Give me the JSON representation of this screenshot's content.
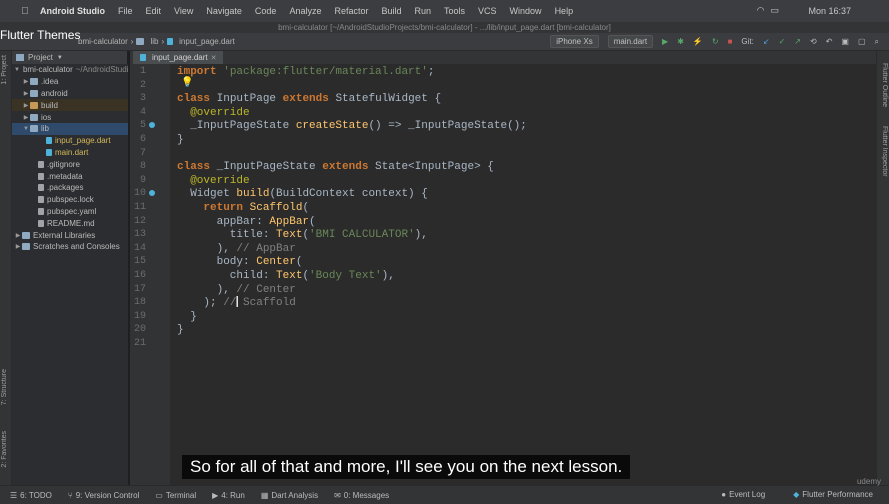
{
  "video_title": "Flutter Themes",
  "menubar": {
    "items": [
      "Android Studio",
      "File",
      "Edit",
      "View",
      "Navigate",
      "Code",
      "Analyze",
      "Refactor",
      "Build",
      "Run",
      "Tools",
      "VCS",
      "Window",
      "Help"
    ],
    "clock": "Mon 16:37"
  },
  "window_title": "bmi-calculator [~/AndroidStudioProjects/bmi-calculator] - .../lib/input_page.dart [bmi-calculator]",
  "navbar": {
    "breadcrumbs": [
      "bmi-calculator",
      "lib",
      "input_page.dart"
    ],
    "device": "iPhone Xs",
    "run_config": "main.dart",
    "git_label": "Git:"
  },
  "project_panel": {
    "header": "Project",
    "tree": [
      {
        "label": "bmi-calculator",
        "suffix": "~/AndroidStudioProjects/bmi-calculator",
        "type": "folder",
        "arrow": "▼"
      },
      {
        "label": ".idea",
        "type": "folder",
        "arrow": "▶"
      },
      {
        "label": "android",
        "type": "folder",
        "arrow": "▶"
      },
      {
        "label": "build",
        "type": "folder-orange",
        "arrow": "▶"
      },
      {
        "label": "ios",
        "type": "folder",
        "arrow": "▶"
      },
      {
        "label": "lib",
        "type": "folder",
        "arrow": "▼"
      },
      {
        "label": "input_page.dart",
        "type": "dart"
      },
      {
        "label": "main.dart",
        "type": "dart"
      },
      {
        "label": ".gitignore",
        "type": "file"
      },
      {
        "label": ".metadata",
        "type": "file"
      },
      {
        "label": ".packages",
        "type": "file"
      },
      {
        "label": "pubspec.lock",
        "type": "file"
      },
      {
        "label": "pubspec.yaml",
        "type": "file"
      },
      {
        "label": "README.md",
        "type": "file"
      },
      {
        "label": "External Libraries",
        "type": "lib",
        "arrow": "▶"
      },
      {
        "label": "Scratches and Consoles",
        "type": "lib",
        "arrow": "▶"
      }
    ]
  },
  "left_strip": {
    "project": "1: Project",
    "structure": "7: Structure",
    "favorites": "2: Favorites"
  },
  "right_strip": {
    "outline": "Flutter Outline",
    "inspector": "Flutter Inspector"
  },
  "editor": {
    "tab": "input_page.dart",
    "line_numbers": [
      "1",
      "2",
      "3",
      "4",
      "5",
      "6",
      "7",
      "8",
      "9",
      "10",
      "11",
      "12",
      "13",
      "14",
      "15",
      "16",
      "17",
      "18",
      "19",
      "20",
      "21"
    ],
    "lines": [
      "import 'package:flutter/material.dart';",
      "",
      "class InputPage extends StatefulWidget {",
      "  @override",
      "  _InputPageState createState() => _InputPageState();",
      "}",
      "",
      "class _InputPageState extends State<InputPage> {",
      "  @override",
      "  Widget build(BuildContext context) {",
      "    return Scaffold(",
      "      appBar: AppBar(",
      "        title: Text('BMI CALCULATOR'),",
      "      ), // AppBar",
      "      body: Center(",
      "        child: Text('Body Text'),",
      "      ), // Center",
      "    ); // Scaffold",
      "  }",
      "}",
      ""
    ]
  },
  "status_bar": {
    "items": [
      "6: TODO",
      "9: Version Control",
      "Terminal",
      "4: Run",
      "Dart Analysis",
      "0: Messages"
    ],
    "right": [
      "Event Log",
      "Flutter Performance"
    ]
  },
  "subtitle": "So for all of that and more, I'll see you on the next lesson.",
  "watermark": "udemy"
}
